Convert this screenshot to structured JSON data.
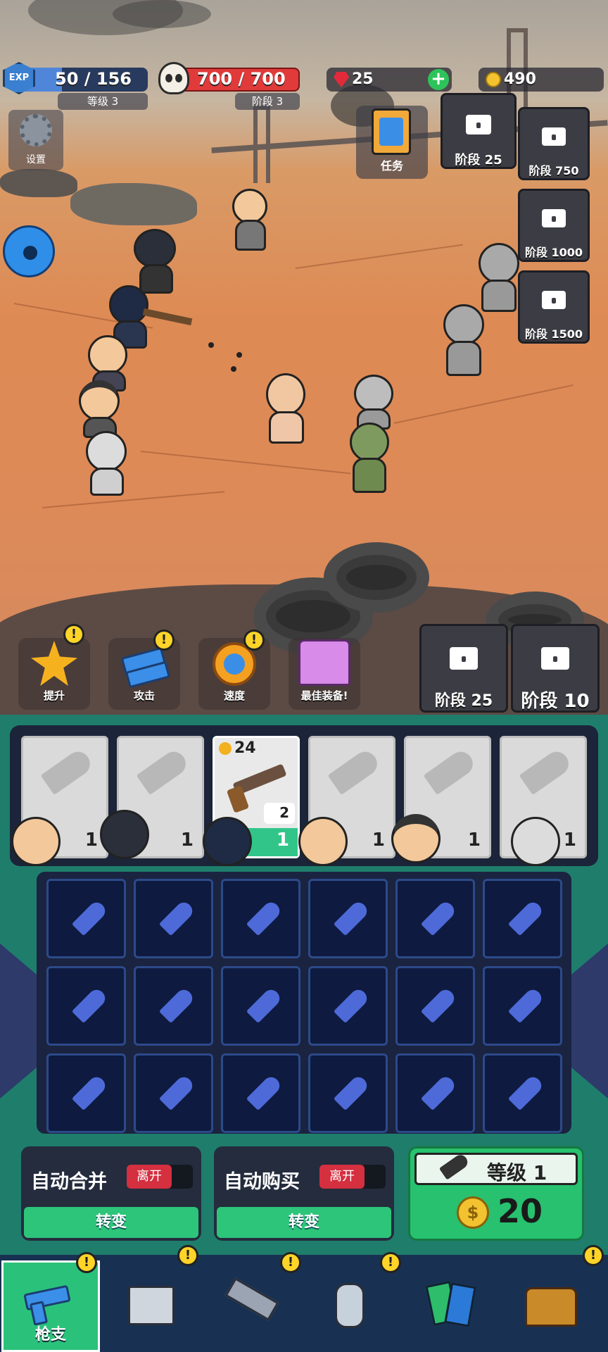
{
  "hud": {
    "exp_icon": "EXP",
    "exp_value": "50 / 156",
    "level_label": "等级 3",
    "hp_value": "700 / 700",
    "stage_label": "阶段 3",
    "gems": "25",
    "coins": "490",
    "settings_label": "设置",
    "tasks_label": "任务",
    "hp_color": "#e03a3a",
    "exp_color": "#4f86d9"
  },
  "locks": {
    "stage25_top": "阶段 25",
    "stage750": "阶段 750",
    "stage1000": "阶段 1000",
    "stage1500": "阶段 1500",
    "stage25_bottom": "阶段 25",
    "stage10": "阶段 10"
  },
  "boosts": {
    "upgrade": "提升",
    "attack": "攻击",
    "speed": "速度",
    "best_gear": "最佳装备!"
  },
  "slots": [
    {
      "count": "1"
    },
    {
      "count": "1"
    },
    {
      "count": "1",
      "power": "24",
      "weapon_level": "2"
    },
    {
      "count": "1"
    },
    {
      "count": "1"
    },
    {
      "count": "1"
    }
  ],
  "controls": {
    "auto_merge": "自动合并",
    "auto_buy": "自动购买",
    "toggle_state": "离开",
    "switch": "转变",
    "buy_level": "等级 1",
    "buy_cost": "20"
  },
  "nav": {
    "guns": "枪支"
  },
  "alert_mark": "!"
}
